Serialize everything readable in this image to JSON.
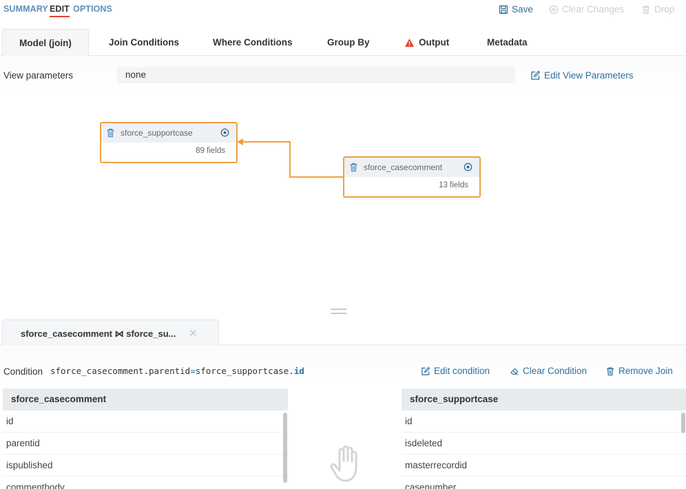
{
  "top_nav": {
    "summary": "SUMMARY",
    "edit": "EDIT",
    "options": "OPTIONS"
  },
  "toolbar": {
    "save": "Save",
    "clear_changes": "Clear Changes",
    "drop": "Drop"
  },
  "tabs": [
    {
      "label": "Model (join)"
    },
    {
      "label": "Join Conditions"
    },
    {
      "label": "Where Conditions"
    },
    {
      "label": "Group By"
    },
    {
      "label": "Output"
    },
    {
      "label": "Metadata"
    }
  ],
  "view_parameters": {
    "label": "View parameters",
    "value": "none",
    "edit_label": "Edit View Parameters"
  },
  "nodes": [
    {
      "name": "sforce_supportcase",
      "fields": "89 fields"
    },
    {
      "name": "sforce_casecomment",
      "fields": "13 fields"
    }
  ],
  "join_tab": {
    "left": "sforce_casecomment",
    "symbol": "⋈",
    "right": "sforce_su...",
    "close": "✕"
  },
  "condition": {
    "label": "Condition",
    "left_expr": "sforce_casecomment.parentid",
    "operator": "=",
    "right_table": "sforce_supportcase.",
    "right_field": "id",
    "edit": "Edit condition",
    "clear": "Clear Condition",
    "remove": "Remove Join"
  },
  "left_table": {
    "title": "sforce_casecomment",
    "fields": [
      "id",
      "parentid",
      "ispublished",
      "commentbody"
    ]
  },
  "right_table": {
    "title": "sforce_supportcase",
    "fields": [
      "id",
      "isdeleted",
      "masterrecordid",
      "casenumber"
    ]
  },
  "colors": {
    "accent": "#2e6f9e",
    "node_border": "#f0a040",
    "active_underline": "#e2442f",
    "warning": "#e2442f"
  },
  "icons": {
    "save": "floppy-icon",
    "clear": "circle-x-icon",
    "drop": "trash-icon",
    "edit": "pencil-square-icon",
    "node_target": "target-icon",
    "drag": "hand-icon"
  }
}
